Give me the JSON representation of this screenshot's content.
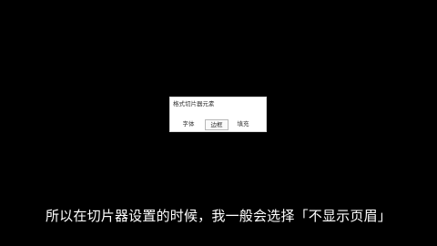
{
  "dialog": {
    "title": "格式切片器元素",
    "tabs": [
      {
        "label": "字体",
        "selected": false
      },
      {
        "label": "边框",
        "selected": true
      },
      {
        "label": "填充",
        "selected": false
      }
    ]
  },
  "subtitle": {
    "text": "所以在切片器设置的时候，我一般会选择「不显示页眉」"
  },
  "colors": {
    "background": "#000000",
    "dialog_background": "#ffffff",
    "subtitle_text": "#ffffff"
  }
}
